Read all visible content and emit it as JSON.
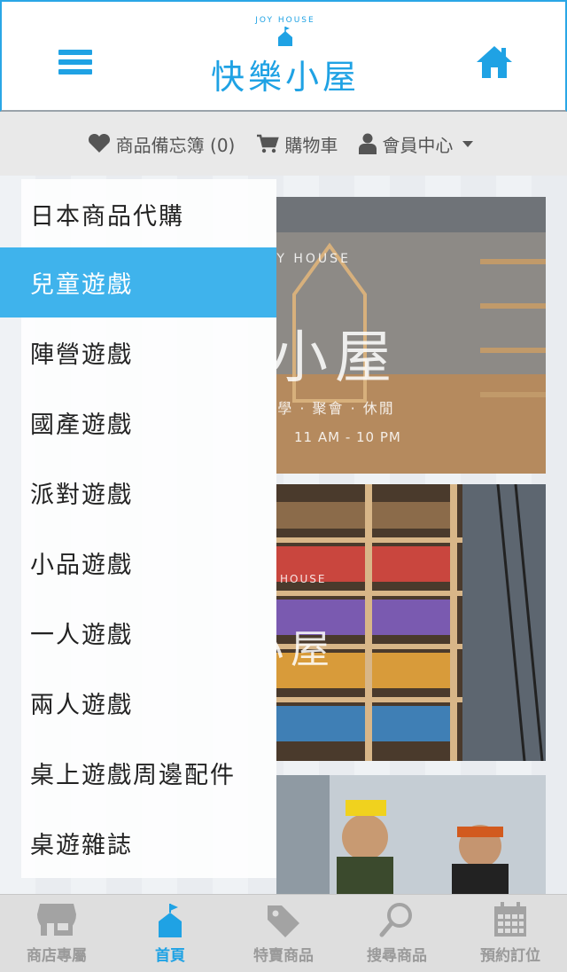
{
  "header": {
    "logo_small": "JOY HOUSE",
    "logo_main": "快樂小屋",
    "accent_color": "#1fa2e4"
  },
  "subnav": {
    "wishlist_label": "商品備忘簿 (0)",
    "cart_label": "購物車",
    "member_label": "會員中心"
  },
  "side_menu": {
    "items": [
      {
        "label": "日本商品代購"
      },
      {
        "label": "兒童遊戲"
      },
      {
        "label": "陣營遊戲"
      },
      {
        "label": "國產遊戲"
      },
      {
        "label": "派對遊戲"
      },
      {
        "label": "小品遊戲"
      },
      {
        "label": "一人遊戲"
      },
      {
        "label": "兩人遊戲"
      },
      {
        "label": "桌上遊戲周邊配件"
      },
      {
        "label": "桌遊雜誌"
      }
    ],
    "active_index": 1
  },
  "photos": {
    "photo1_title": "快樂小屋",
    "photo1_sub": "桌遊租售 · 教學 · 聚會 · 休閒",
    "photo1_hours": "11 AM - 10 PM",
    "photo1_brand": "JOY HOUSE",
    "photo2_title": "快樂小屋",
    "photo2_brand": "HOUSE"
  },
  "tabbar": {
    "tabs": [
      {
        "label": "商店專屬",
        "icon": "storefront-icon"
      },
      {
        "label": "首頁",
        "icon": "house-flag-icon"
      },
      {
        "label": "特賣商品",
        "icon": "price-tag-icon"
      },
      {
        "label": "搜尋商品",
        "icon": "search-icon"
      },
      {
        "label": "預約訂位",
        "icon": "calendar-icon"
      }
    ],
    "active_index": 1
  }
}
